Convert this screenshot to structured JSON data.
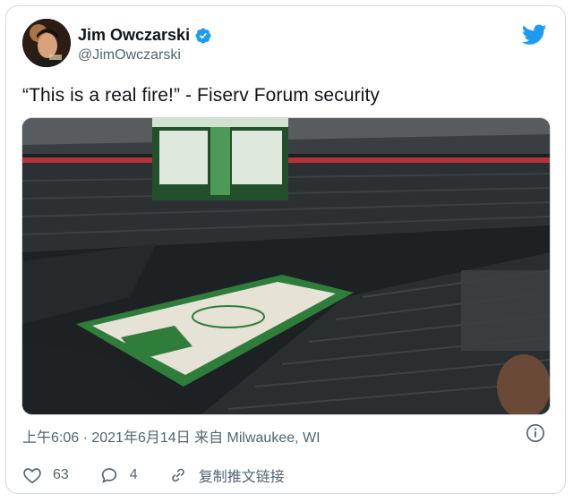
{
  "author": {
    "name": "Jim Owczarski",
    "handle": "@JimOwczarski",
    "verified": true
  },
  "tweet": {
    "text": "“This is a real fire!” - Fiserv Forum security"
  },
  "meta": {
    "timestamp": "上午6:06 · 2021年6月14日 来自 Milwaukee, WI"
  },
  "actions": {
    "likes": "63",
    "replies": "4",
    "copy_link_label": "复制推文链接"
  },
  "colors": {
    "twitter_blue": "#1d9bf0",
    "secondary_text": "#536471",
    "court_green": "#2f7d3a",
    "seat_dark": "#2a2d2e"
  },
  "icons": {
    "verified": "verified-badge-icon",
    "logo": "twitter-bird-icon",
    "info": "info-icon",
    "like": "heart-icon",
    "reply": "reply-icon",
    "link": "link-icon"
  }
}
